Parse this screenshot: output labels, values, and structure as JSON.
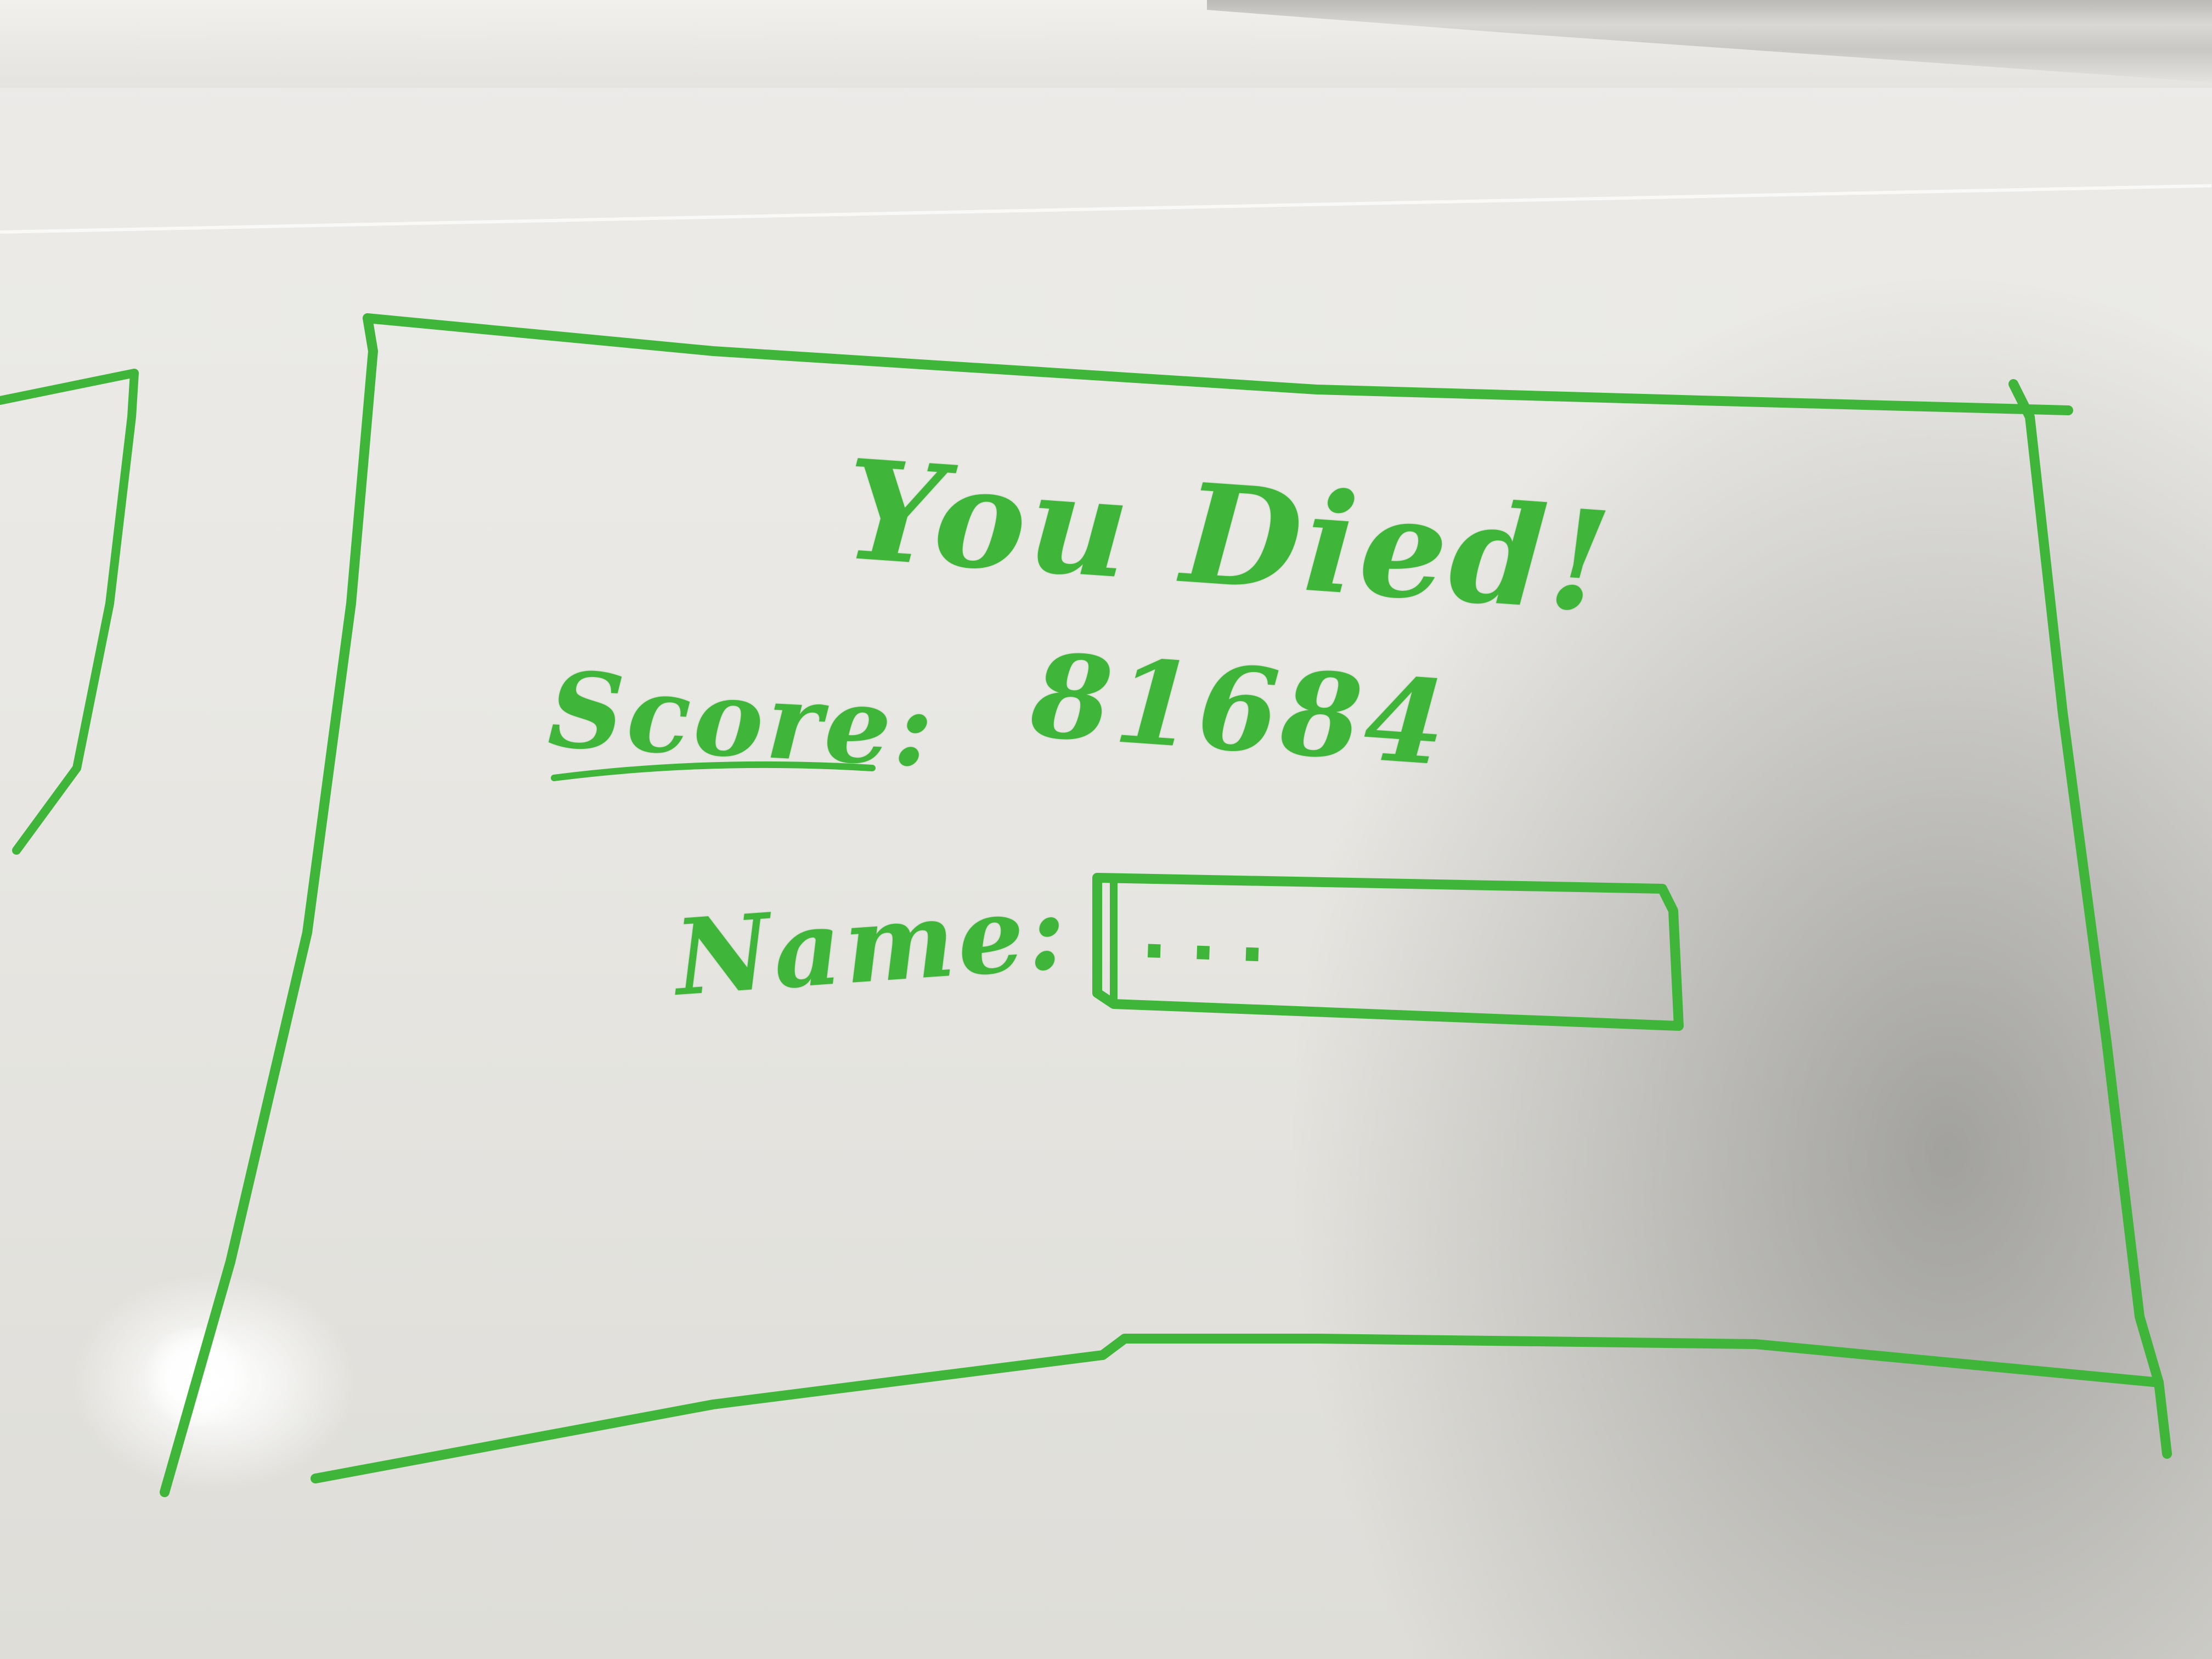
{
  "sketch": {
    "title": "You Died!",
    "score_label": "Score:",
    "score_value": "81684",
    "name_label": "Name:",
    "name_placeholder": "..."
  },
  "colors": {
    "ink": "#3fb53a",
    "board": "#e9e8e4"
  }
}
